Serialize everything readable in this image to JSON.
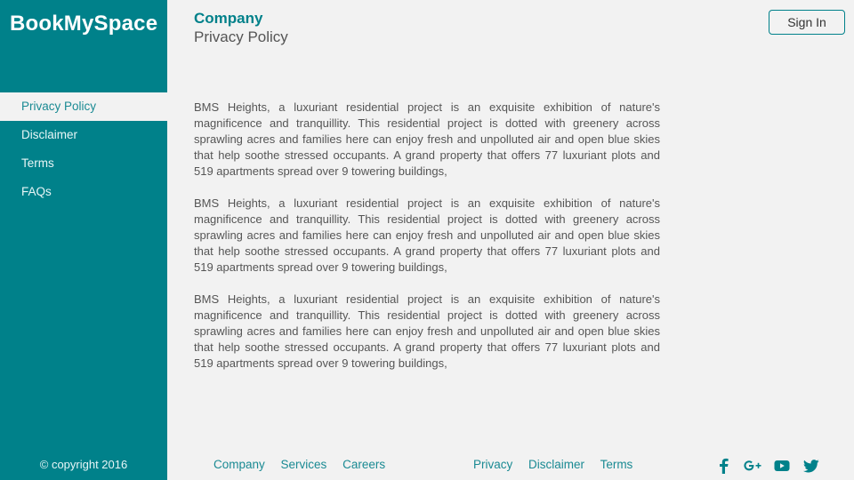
{
  "brand": "BookMySpace",
  "header": {
    "title": "Company",
    "subtitle": "Privacy Policy"
  },
  "signin_label": "Sign In",
  "sidebar": {
    "items": [
      {
        "label": "Privacy Policy",
        "active": true
      },
      {
        "label": "Disclaimer",
        "active": false
      },
      {
        "label": "Terms",
        "active": false
      },
      {
        "label": "FAQs",
        "active": false
      }
    ],
    "copyright": "© copyright 2016"
  },
  "content": {
    "paragraphs": [
      "BMS Heights, a luxuriant residential project is an exquisite exhibition of nature's magnificence and tranquillity. This residential project is dotted with greenery across sprawling acres and families here can enjoy fresh and unpolluted air and open blue skies that help soothe stressed occupants. A grand property that offers 77 luxuriant plots and 519 apartments spread over 9 towering buildings,",
      "BMS Heights, a luxuriant residential project is an exquisite exhibition of nature's magnificence and tranquillity. This residential project is dotted with greenery across sprawling acres and families here can enjoy fresh and unpolluted air and open blue skies that help soothe stressed occupants. A grand property that offers 77 luxuriant plots and 519 apartments spread over 9 towering buildings,",
      "BMS Heights, a luxuriant residential project is an exquisite exhibition of nature's magnificence and tranquillity. This residential project is dotted with greenery across sprawling acres and families here can enjoy fresh and unpolluted air and open blue skies that help soothe stressed occupants. A grand property that offers 77 luxuriant plots and 519 apartments spread over 9 towering buildings,"
    ]
  },
  "footer": {
    "left_links": [
      "Company",
      "Services",
      "Careers"
    ],
    "right_links": [
      "Privacy",
      "Disclaimer",
      "Terms"
    ],
    "social_icons": [
      "facebook-icon",
      "google-plus-icon",
      "youtube-icon",
      "twitter-icon"
    ]
  },
  "colors": {
    "accent": "#00818a",
    "background": "#f2f2f2",
    "text": "#555555"
  }
}
